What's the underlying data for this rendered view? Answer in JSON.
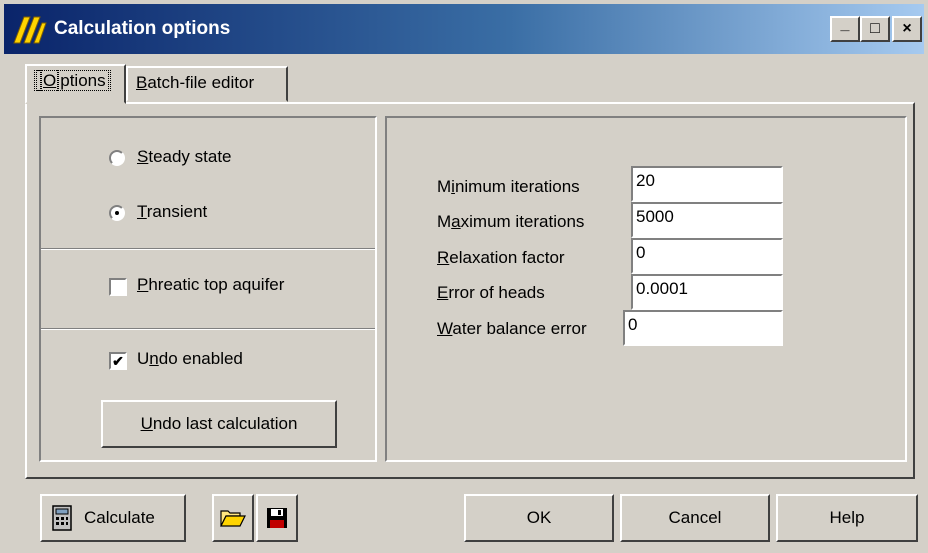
{
  "window": {
    "title": "Calculation options"
  },
  "caption_buttons": [
    "_",
    "□",
    "×"
  ],
  "tabs": [
    {
      "pre": "",
      "ul": "O",
      "post": "ptions",
      "active": true
    },
    {
      "pre": "",
      "ul": "B",
      "post": "atch-file editor",
      "active": false
    }
  ],
  "mode": {
    "steady": {
      "pre": "",
      "ul": "S",
      "post": "teady state",
      "selected": false
    },
    "transient": {
      "pre": "",
      "ul": "T",
      "post": "ransient",
      "selected": true
    }
  },
  "phreatic": {
    "pre": "",
    "ul": "P",
    "post": "hreatic top aquifer",
    "checked": false
  },
  "undo": {
    "enabled": {
      "pre": "U",
      "ul": "n",
      "post": "do enabled",
      "checked": true
    },
    "last_button": {
      "pre": "",
      "ul": "U",
      "post": "ndo last calculation"
    }
  },
  "params": [
    {
      "pre": "M",
      "ul": "i",
      "post": "nimum iterations",
      "value": "20"
    },
    {
      "pre": "M",
      "ul": "a",
      "post": "ximum iterations",
      "value": "5000"
    },
    {
      "pre": "",
      "ul": "R",
      "post": "elaxation factor",
      "value": "0"
    },
    {
      "pre": "",
      "ul": "E",
      "post": "rror of heads",
      "value": "0.0001"
    },
    {
      "pre": "",
      "ul": "W",
      "post": "ater balance error",
      "value": "0"
    }
  ],
  "bottom": {
    "calculate": "Calculate",
    "ok": "OK",
    "cancel": "Cancel",
    "help": "Help"
  },
  "icons": {
    "app": "yellow-stripes-icon",
    "calculate": "calculator-icon",
    "open": "folder-open-icon",
    "save": "floppy-disk-icon"
  },
  "colors": {
    "face": "#d4d0c8",
    "title_start": "#0a246a",
    "title_end": "#a6caf0"
  }
}
